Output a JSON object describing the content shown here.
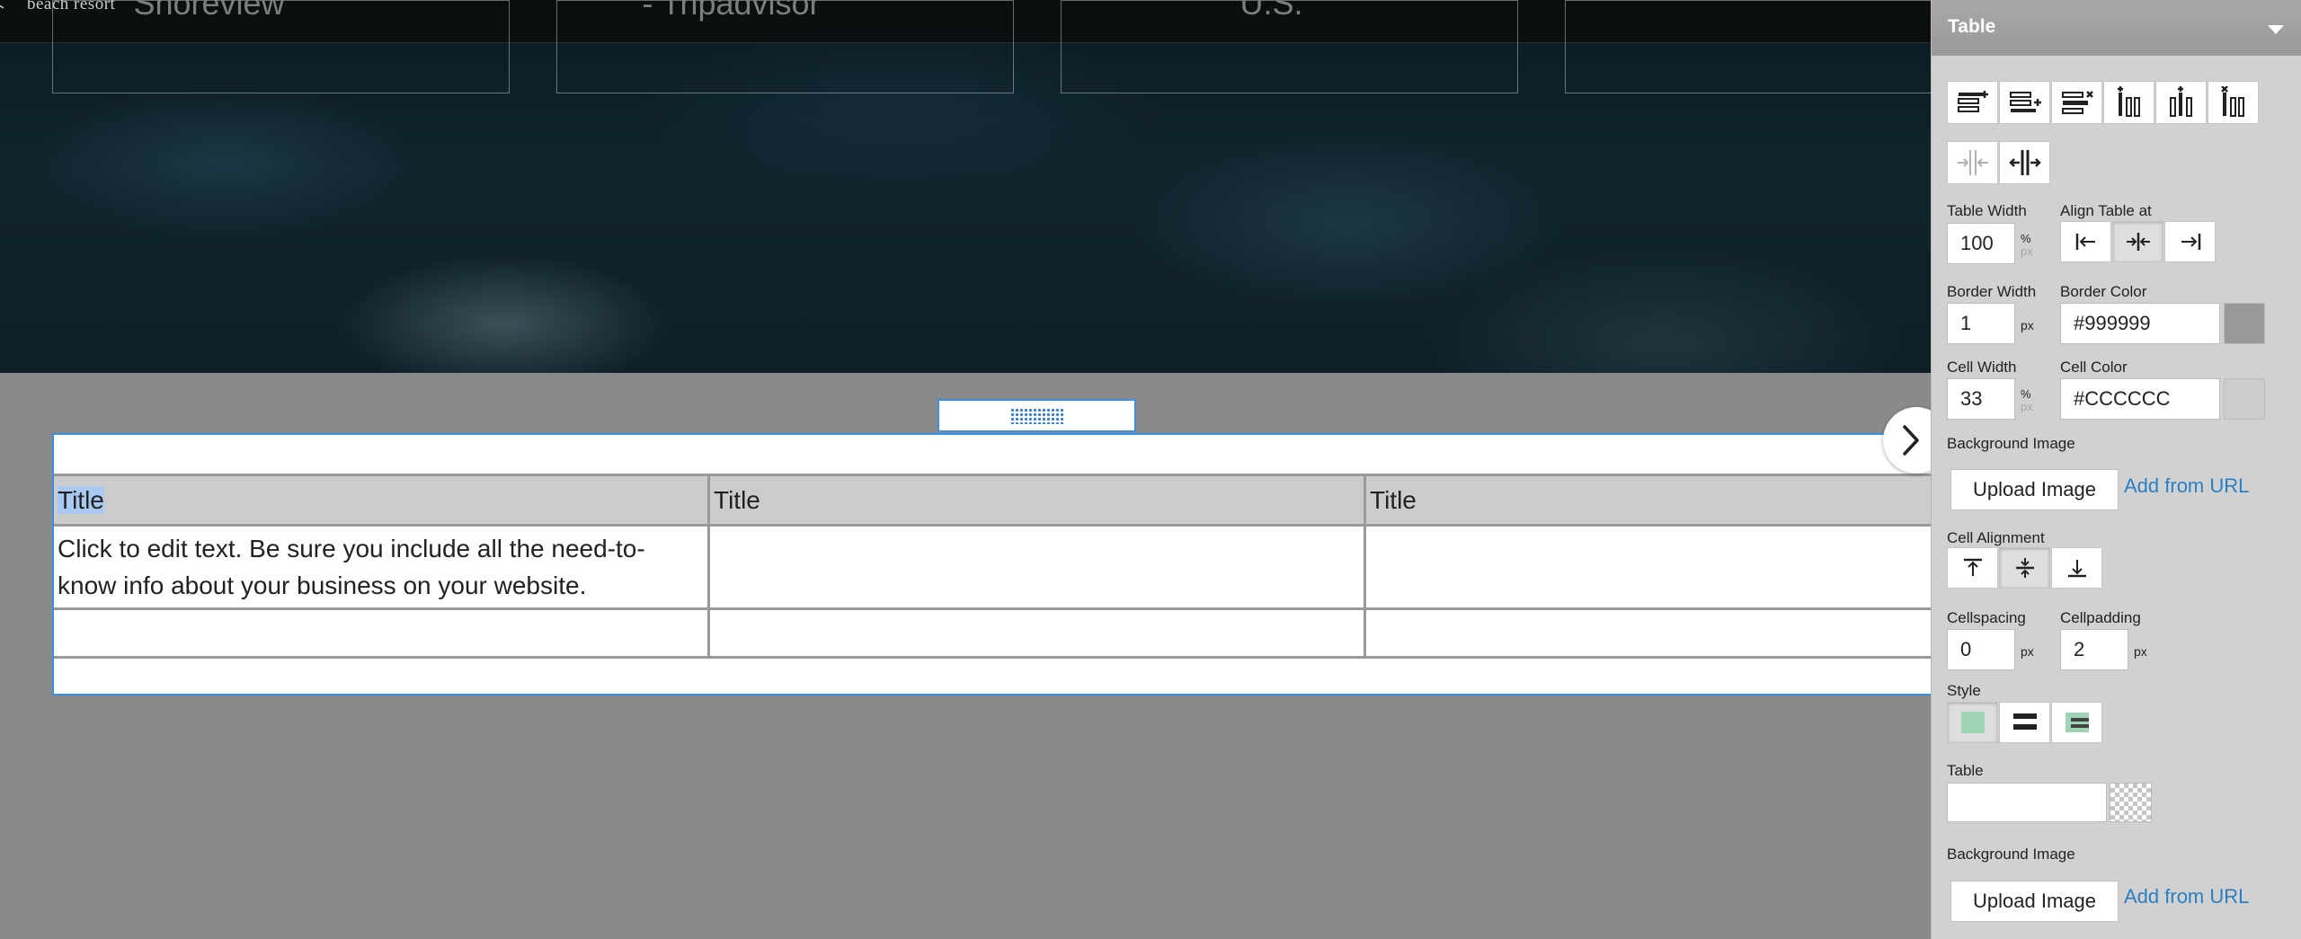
{
  "site": {
    "brand_sub": "beach resort",
    "hero_boxes": [
      "Shoreview",
      "- Tripadvisor",
      "U.S.",
      ""
    ]
  },
  "table": {
    "headers": [
      "Title",
      "Title",
      "Title"
    ],
    "body_text": "Click to edit text. Be sure you include all the need-to-know info about your business on your website."
  },
  "panel": {
    "title": "Table",
    "table_width_label": "Table Width",
    "table_width_value": "100",
    "unit_percent": "%",
    "unit_px": "px",
    "align_label": "Align Table at",
    "border_width_label": "Border Width",
    "border_width_value": "1",
    "border_color_label": "Border Color",
    "border_color_value": "#999999",
    "cell_width_label": "Cell Width",
    "cell_width_value": "33",
    "cell_color_label": "Cell Color",
    "cell_color_value": "#CCCCCC",
    "bg_image_label": "Background Image",
    "upload_label": "Upload Image",
    "add_url_label": "Add from URL",
    "cell_alignment_label": "Cell Alignment",
    "cellspacing_label": "Cellspacing",
    "cellspacing_value": "0",
    "cellpadding_label": "Cellpadding",
    "cellpadding_value": "2",
    "style_label": "Style",
    "table_label": "Table",
    "table_value": "",
    "bg_image_label_2": "Background Image",
    "upload_label_2": "Upload Image",
    "add_url_label_2": "Add from URL"
  },
  "colors": {
    "selection_blue": "#3a8fe0",
    "link_blue": "#2a7fc3",
    "border_swatch": "#999999",
    "cell_swatch": "#cccccc",
    "style_green": "#9fd4b4"
  }
}
